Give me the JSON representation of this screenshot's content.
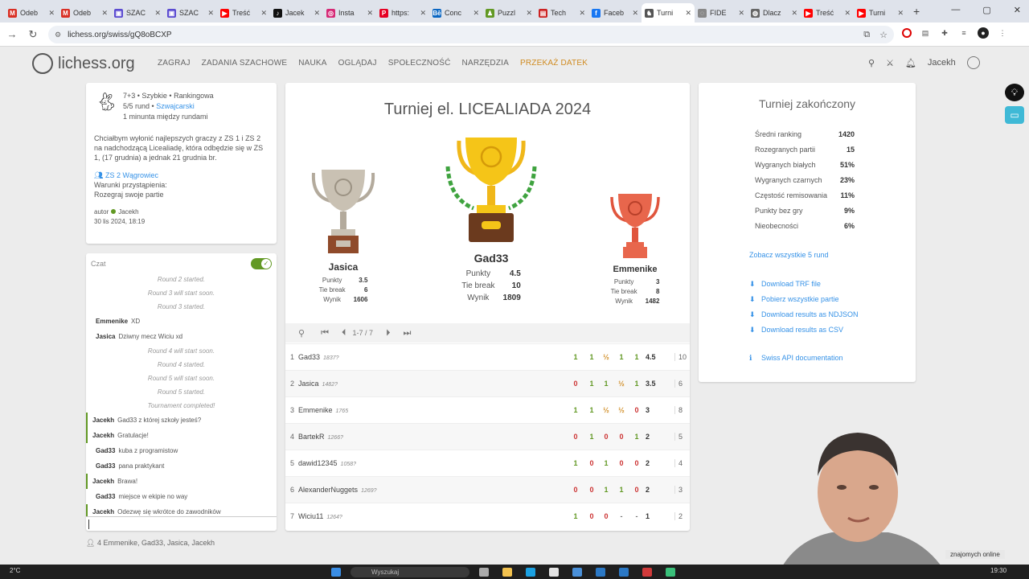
{
  "browser": {
    "tabs": [
      {
        "label": "Odeb",
        "color": "#d93025",
        "glyph": "M"
      },
      {
        "label": "Odeb",
        "color": "#d93025",
        "glyph": "M"
      },
      {
        "label": "SZAC",
        "color": "#5b4bd1",
        "glyph": "▣"
      },
      {
        "label": "SZAC",
        "color": "#5b4bd1",
        "glyph": "▣"
      },
      {
        "label": "Treść",
        "color": "#ff0000",
        "glyph": "▶"
      },
      {
        "label": "Jacek",
        "color": "#111111",
        "glyph": "♪"
      },
      {
        "label": "Insta",
        "color": "#d62976",
        "glyph": "◎"
      },
      {
        "label": "https:",
        "color": "#e60023",
        "glyph": "P"
      },
      {
        "label": "Conc",
        "color": "#0a66c2",
        "glyph": "Bē"
      },
      {
        "label": "Puzzl",
        "color": "#629924",
        "glyph": "♟"
      },
      {
        "label": "Tech",
        "color": "#cc2222",
        "glyph": "▤"
      },
      {
        "label": "Faceb",
        "color": "#1877f2",
        "glyph": "f"
      },
      {
        "label": "Turni",
        "color": "#555555",
        "glyph": "♞",
        "active": true
      },
      {
        "label": "FIDE",
        "color": "#888888",
        "glyph": "◌"
      },
      {
        "label": "Dlacz",
        "color": "#666666",
        "glyph": "◍"
      },
      {
        "label": "Treść",
        "color": "#ff0000",
        "glyph": "▶"
      },
      {
        "label": "Turni",
        "color": "#ff0000",
        "glyph": "▶"
      }
    ],
    "url": "lichess.org/swiss/gQ8oBCXP"
  },
  "nav": {
    "brand": "lichess.org",
    "menu": [
      "ZAGRAJ",
      "ZADANIA SZACHOWE",
      "NAUKA",
      "OGLĄDAJ",
      "SPOŁECZNOŚĆ",
      "NARZĘDZIA"
    ],
    "donate": "PRZEKAŻ DATEK",
    "user": "Jacekh"
  },
  "info": {
    "line1": "7+3 • Szybkie • Rankingowa",
    "line2_prefix": "5/5 rund • ",
    "line2_link": "Szwajcarski",
    "line3": "1 minunta między rundami",
    "description": "Chciałbym wyłonić najlepszych graczy z ZS 1 i ZS 2 na nadchodzącą Licealiadę, która odbędzie się w ZS 1, (17 grudnia) a jednak 21 grudnia br.",
    "team": "ZS 2 Wągrowiec",
    "conditions_label": "Warunki przystąpienia:",
    "conditions": "Rozegraj swoje partie",
    "author_label": "autor",
    "author": "Jacekh",
    "date": "30 lis 2024, 18:19"
  },
  "chat": {
    "label": "Czat",
    "messages": [
      {
        "sys": "Round 2 started."
      },
      {
        "sys": "Round 3 will start soon."
      },
      {
        "sys": "Round 3 started."
      },
      {
        "user": "Emmenike",
        "text": "XD"
      },
      {
        "user": "Jasica",
        "text": "Dziwny mecz Wiciu xd"
      },
      {
        "sys": "Round 4 will start soon."
      },
      {
        "sys": "Round 4 started."
      },
      {
        "sys": "Round 5 will start soon."
      },
      {
        "sys": "Round 5 started."
      },
      {
        "sys": "Tournament completed!"
      },
      {
        "user": "Jacekh",
        "text": "Gad33 z której szkoły jesteś?",
        "me": true
      },
      {
        "user": "Jacekh",
        "text": "Gratulacje!",
        "me": true
      },
      {
        "user": "Gad33",
        "text": "kuba z programistow"
      },
      {
        "user": "Gad33",
        "text": "pana praktykant"
      },
      {
        "user": "Jacekh",
        "text": "Brawa!",
        "me": true
      },
      {
        "user": "Gad33",
        "text": "miejsce w ekipie no way"
      },
      {
        "user": "Jacekh",
        "text": "Odezwę się wkrótce do zawodników",
        "me": true
      }
    ],
    "players_count": "4",
    "players": "Emmenike, Gad33, Jasica, Jacekh"
  },
  "tournament": {
    "title": "Turniej el. LICEALIADA 2024",
    "podium": [
      {
        "place": "second",
        "name": "Jasica",
        "points": "3.5",
        "tiebreak": "6",
        "rating": "1606",
        "color": "#b3aa9c"
      },
      {
        "place": "first",
        "name": "Gad33",
        "points": "4.5",
        "tiebreak": "10",
        "rating": "1809",
        "color": "#f0b719"
      },
      {
        "place": "third",
        "name": "Emmenike",
        "points": "3",
        "tiebreak": "8",
        "rating": "1482",
        "color": "#e0553d"
      }
    ],
    "labels": {
      "points": "Punkty",
      "tiebreak": "Tie break",
      "rating": "Wynik"
    },
    "pager": "1-7 / 7",
    "standings": [
      {
        "rank": "1",
        "name": "Gad33",
        "rating": "1837?",
        "scores": [
          "1",
          "1",
          "½",
          "1",
          "1"
        ],
        "points": "4.5",
        "tb": "10"
      },
      {
        "rank": "2",
        "name": "Jasica",
        "rating": "1482?",
        "scores": [
          "0",
          "1",
          "1",
          "½",
          "1"
        ],
        "points": "3.5",
        "tb": "6"
      },
      {
        "rank": "3",
        "name": "Emmenike",
        "rating": "1765",
        "scores": [
          "1",
          "1",
          "½",
          "½",
          "0"
        ],
        "points": "3",
        "tb": "8"
      },
      {
        "rank": "4",
        "name": "BartekR",
        "rating": "1266?",
        "scores": [
          "0",
          "1",
          "0",
          "0",
          "1"
        ],
        "points": "2",
        "tb": "5"
      },
      {
        "rank": "5",
        "name": "dawid12345",
        "rating": "1058?",
        "scores": [
          "1",
          "0",
          "1",
          "0",
          "0"
        ],
        "points": "2",
        "tb": "4"
      },
      {
        "rank": "6",
        "name": "AlexanderNuggets",
        "rating": "1269?",
        "scores": [
          "0",
          "0",
          "1",
          "1",
          "0"
        ],
        "points": "2",
        "tb": "3"
      },
      {
        "rank": "7",
        "name": "Wiciu11",
        "rating": "1264?",
        "scores": [
          "1",
          "0",
          "0",
          "-",
          "-"
        ],
        "points": "1",
        "tb": "2"
      }
    ]
  },
  "stats": {
    "title": "Turniej zakończony",
    "rows": [
      {
        "label": "Średni ranking",
        "value": "1420"
      },
      {
        "label": "Rozegranych partii",
        "value": "15"
      },
      {
        "label": "Wygranych białych",
        "value": "51%"
      },
      {
        "label": "Wygranych czarnych",
        "value": "23%"
      },
      {
        "label": "Częstość remisowania",
        "value": "11%"
      },
      {
        "label": "Punkty bez gry",
        "value": "9%"
      },
      {
        "label": "Nieobecności",
        "value": "6%"
      }
    ],
    "rounds_link": "Zobacz wszystkie 5 rund",
    "downloads": [
      "Download TRF file",
      "Pobierz wszystkie partie",
      "Download results as NDJSON",
      "Download results as CSV"
    ],
    "api": "Swiss API documentation"
  },
  "taskbar": {
    "weather": "2°C",
    "search": "Wyszukaj",
    "time": "19:30",
    "notification": "znajomych online"
  }
}
